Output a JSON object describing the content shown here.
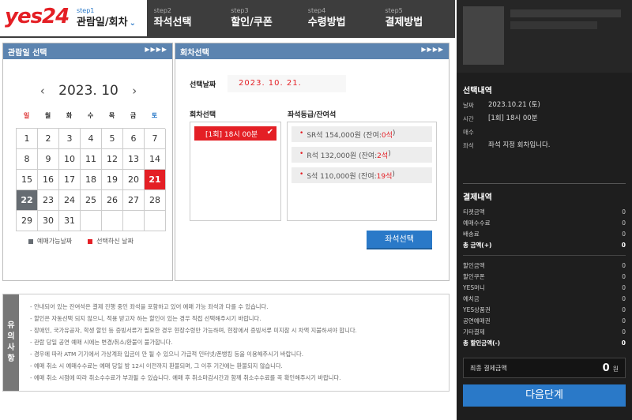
{
  "logo": "yes24",
  "steps": [
    {
      "num": "step1",
      "label": "관람일/회차"
    },
    {
      "num": "step2",
      "label": "좌석선택"
    },
    {
      "num": "step3",
      "label": "할인/쿠폰"
    },
    {
      "num": "step4",
      "label": "수령방법"
    },
    {
      "num": "step5",
      "label": "결제방법"
    }
  ],
  "calendar": {
    "panel_title": "관람일 선택",
    "arrows": "▶▶▶▶",
    "month": "2023. 10",
    "weekdays": [
      "일",
      "월",
      "화",
      "수",
      "목",
      "금",
      "토"
    ],
    "weeks": [
      [
        "1",
        "2",
        "3",
        "4",
        "5",
        "6",
        "7"
      ],
      [
        "8",
        "9",
        "10",
        "11",
        "12",
        "13",
        "14"
      ],
      [
        "15",
        "16",
        "17",
        "18",
        "19",
        "20",
        "21"
      ],
      [
        "22",
        "23",
        "24",
        "25",
        "26",
        "27",
        "28"
      ],
      [
        "29",
        "30",
        "31",
        "",
        "",
        "",
        ""
      ]
    ],
    "selected_day": "21",
    "available_day": "22",
    "legend_available": "예매가능날짜",
    "legend_selected": "선택하신 날짜",
    "legend_available_color": "#666c72",
    "legend_selected_color": "#e41f25"
  },
  "seat": {
    "panel_title": "회차선택",
    "arrows": "▶▶▶▶",
    "date_label": "선택날짜",
    "date_value": "2023. 10. 21.",
    "round_label": "회차선택",
    "grade_label": "좌석등급/잔여석",
    "round_item": "[1회] 18시 00분",
    "grades": [
      {
        "text": "SR석 154,000원 (잔여:",
        "remain": "0석",
        "close": ")"
      },
      {
        "text": "R석 132,000원 (잔여:",
        "remain": "2석",
        "close": ")"
      },
      {
        "text": "S석 110,000원 (잔여:",
        "remain": "19석",
        "close": ")"
      }
    ],
    "select_button": "좌석선택"
  },
  "notice": {
    "tag": [
      "유",
      "의",
      "사",
      "항"
    ],
    "lines": [
      "- 안내되어 있는 잔여석은 결제 진행 중인 좌석을 포함하고 있어 예매 가능 좌석과 다를 수 있습니다.",
      "- 할인은 자동선택 되지 않으니, 적용 받고자 하는 할인이 있는 경우 직접 선택해주시기 바랍니다.",
      "- 장애인, 국가유공자, 학생 할인 등 증빙서류가 필요한 경우 현장수령만 가능하며, 현장에서 증빙서류 미지참 시 차액 지불하셔야 합니다.",
      "- 관람 당일 공연 예매 시에는 변경/취소/환불이 불가합니다.",
      "- 경우에 따라 ATM 기기에서 가상계좌 입금이 안 될 수 있으니 가급적 인터넷/폰뱅킹 등을 이용해주시기 바랍니다.",
      "- 예매 취소 시 예매수수료는 예매 당일 밤 12시 이전까지 환불되며, 그 이후 기간에는 환불되지 않습니다.",
      "- 예매 취소 시점에 따라 취소수수료가 부과될 수 있습니다. 예매 후 취소마감시간과 함께 취소수수료를 꼭 확인해주시기 바랍니다."
    ]
  },
  "sidebar": {
    "selection_title": "선택내역",
    "rows": [
      {
        "k": "날짜",
        "v": "2023.10.21 (토)"
      },
      {
        "k": "시간",
        "v": "[1회] 18시 00분"
      },
      {
        "k": "매수",
        "v": ""
      },
      {
        "k": "좌석",
        "v": "좌석 지정 회차입니다."
      }
    ],
    "payment_title": "결제내역",
    "pay_group1": [
      {
        "k": "티켓금액",
        "v": "0",
        "bold": false
      },
      {
        "k": "예매수수료",
        "v": "0",
        "bold": false
      },
      {
        "k": "배송료",
        "v": "0",
        "bold": false
      },
      {
        "k": "총 금액(+)",
        "v": "0",
        "bold": true
      }
    ],
    "pay_group2": [
      {
        "k": "할인금액",
        "v": "0",
        "bold": false
      },
      {
        "k": "할인쿠폰",
        "v": "0",
        "bold": false
      },
      {
        "k": "YES머니",
        "v": "0",
        "bold": false
      },
      {
        "k": "예치금",
        "v": "0",
        "bold": false
      },
      {
        "k": "YES상품권",
        "v": "0",
        "bold": false
      },
      {
        "k": "공연예매권",
        "v": "0",
        "bold": false
      },
      {
        "k": "기타결제",
        "v": "0",
        "bold": false
      },
      {
        "k": "총 할인금액(-)",
        "v": "0",
        "bold": true
      }
    ],
    "final_label": "최종 결제금액",
    "final_amount": "0",
    "final_unit": "원",
    "next_button": "다음단계"
  }
}
